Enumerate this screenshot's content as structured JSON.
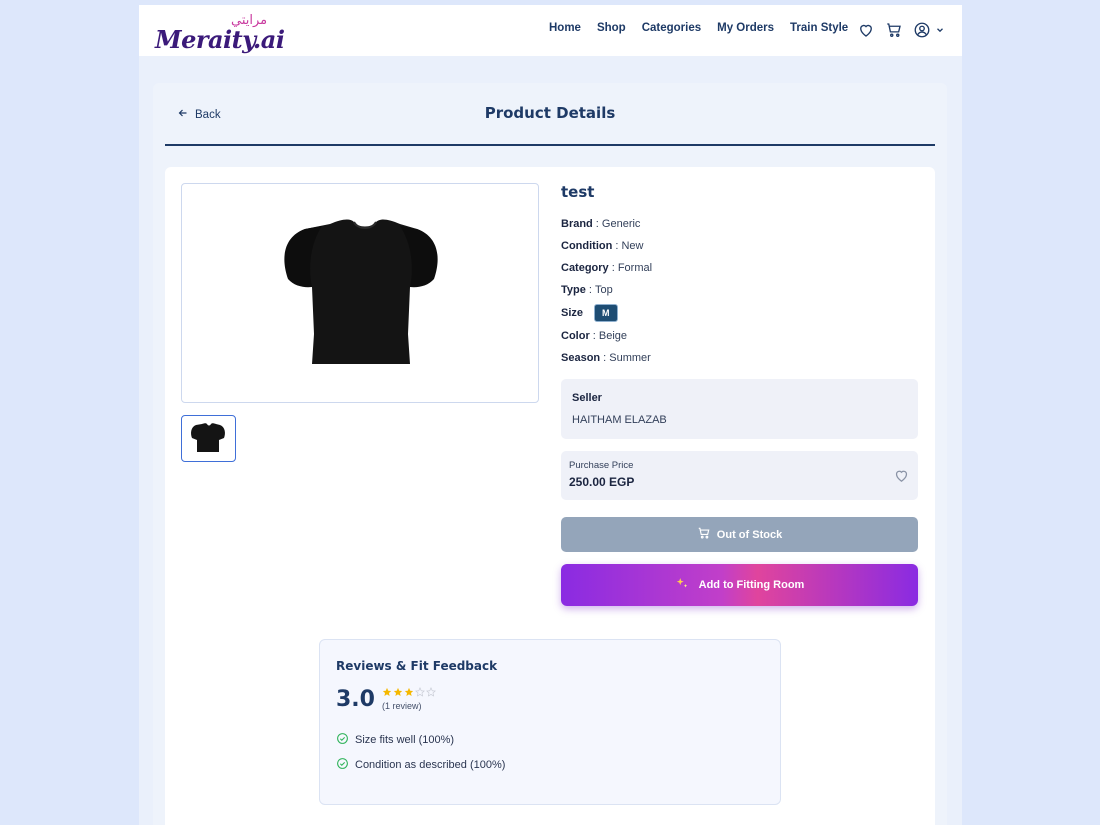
{
  "app": {
    "logo_text": "Meraity.ai",
    "logo_arabic": "مرايتي"
  },
  "nav": {
    "items": [
      "Home",
      "Shop",
      "Categories",
      "My Orders",
      "Train Style"
    ],
    "icons": [
      "heart-icon",
      "cart-icon",
      "user-icon",
      "chevron-down-icon"
    ]
  },
  "page": {
    "back_label": "Back",
    "title": "Product Details"
  },
  "product": {
    "name": "test",
    "attributes": [
      {
        "label": "Brand",
        "value": "Generic"
      },
      {
        "label": "Condition",
        "value": "New"
      },
      {
        "label": "Category",
        "value": "Formal"
      },
      {
        "label": "Type",
        "value": "Top"
      }
    ],
    "size_label": "Size",
    "size_value": "M",
    "attributes_after": [
      {
        "label": "Color",
        "value": "Beige"
      },
      {
        "label": "Season",
        "value": "Summer"
      }
    ],
    "seller_label": "Seller",
    "seller_name": "HAITHAM ELAZAB",
    "price_label": "Purchase Price",
    "price_value": "250.00 EGP",
    "out_of_stock_label": "Out of Stock",
    "fitting_room_label": "Add to Fitting Room"
  },
  "reviews": {
    "title": "Reviews & Fit Feedback",
    "score": "3.0",
    "stars": 3,
    "max_stars": 5,
    "count": "(1 review)",
    "feedback": [
      "Size fits well (100%)",
      "Condition as described (100%)"
    ]
  },
  "colors": {
    "primary": "#1e3a66",
    "accent_purple": "#8a2be2",
    "accent_pink": "#e0449d",
    "disabled": "#94a5ba",
    "star": "#f5b800",
    "check": "#2fb35a"
  }
}
